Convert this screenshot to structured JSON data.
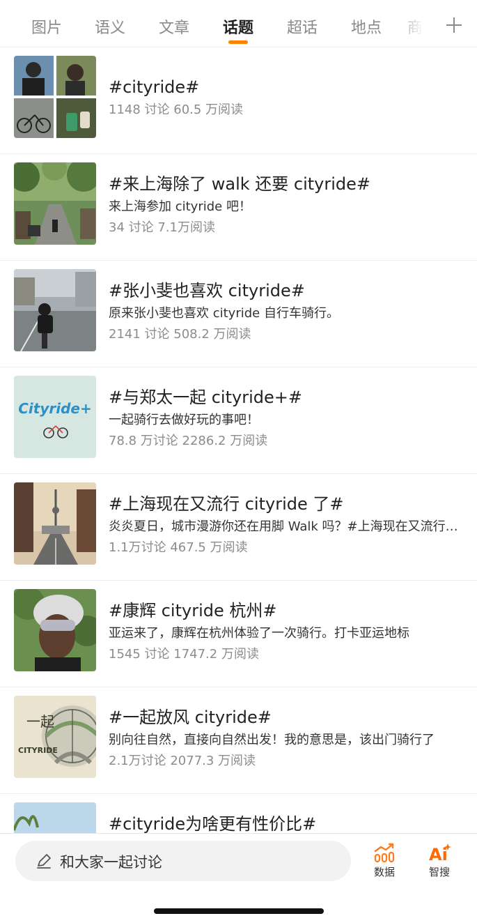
{
  "tabs": [
    {
      "label": "图片"
    },
    {
      "label": "语义"
    },
    {
      "label": "文章"
    },
    {
      "label": "话题"
    },
    {
      "label": "超话"
    },
    {
      "label": "地点"
    },
    {
      "label": "商"
    }
  ],
  "active_tab": "话题",
  "accent_color": "#ff8200",
  "topics": [
    {
      "title": "#cityride#",
      "desc": "",
      "stats": "1148 讨论 60.5 万阅读",
      "thumb": "photo-collage"
    },
    {
      "title": "#来上海除了 walk 还要 cityride#",
      "desc": "来上海参加 cityride 吧！",
      "stats": "34 讨论 7.1万阅读",
      "thumb": "tree-lined-street-photo"
    },
    {
      "title": "#张小斐也喜欢 cityride#",
      "desc": "原来张小斐也喜欢 cityride 自行车骑行。",
      "stats": "2141 讨论 508.2 万阅读",
      "thumb": "cyclist-on-road-photo"
    },
    {
      "title": "#与郑太一起 cityride+#",
      "desc": "一起骑行去做好玩的事吧！",
      "stats": "78.8 万讨论 2286.2 万阅读",
      "thumb": "cityride-plus-logo",
      "thumb_text": "Cityride+"
    },
    {
      "title": "#上海现在又流行 cityride 了#",
      "desc": "炎炎夏日，城市漫游你还在用脚 Walk 吗？#上海现在又流行 cityride 了#",
      "stats": "1.1万讨论 467.5 万阅读",
      "thumb": "shanghai-skyline-photo"
    },
    {
      "title": "#康辉 cityride 杭州#",
      "desc": "亚运来了，康辉在杭州体验了一次骑行。打卡亚运地标",
      "stats": "1545 讨论 1747.2 万阅读",
      "thumb": "helmet-selfie-photo"
    },
    {
      "title": "#一起放风 cityride#",
      "desc": "别向往自然，直接向自然出发！我的意思是，该出门骑行了",
      "stats": "2.1万讨论 2077.3 万阅读",
      "thumb": "poster-wheel-art",
      "thumb_text": "CITYRIDE"
    },
    {
      "title": "#cityride为啥更有性价比#",
      "desc": "",
      "stats": "",
      "thumb": "sky-trees-photo"
    }
  ],
  "bottom_bar": {
    "discuss_placeholder": "和大家一起讨论",
    "data_label": "数据",
    "ai_label": "智搜",
    "ai_icon_text": "Ai"
  }
}
